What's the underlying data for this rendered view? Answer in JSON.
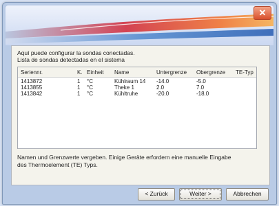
{
  "dialog": {
    "intro_line1": "Aquí puede configurar la sondas conectadas.",
    "intro_line2": "Lista de sondas detectadas en el sistema",
    "close_glyph": "✕"
  },
  "table": {
    "headers": [
      "Seriennr.",
      "K.",
      "Einheit",
      "Name",
      "Untergrenze",
      "Obergrenze",
      "TE-Typ"
    ],
    "rows": [
      [
        "1413872",
        "1",
        "°C",
        "Kühlraum 14",
        "-14.0",
        "-5.0",
        ""
      ],
      [
        "1413855",
        "1",
        "°C",
        "Theke 1",
        "2.0",
        "7.0",
        ""
      ],
      [
        "1413842",
        "1",
        "°C",
        "Kühltruhe",
        "-20.0",
        "-18.0",
        ""
      ]
    ]
  },
  "footer": {
    "line1": "Namen und Grenzwerte vergeben. Einige Geräte erfordern eine manuelle Eingabe",
    "line2": "des Thermoelement (TE) Typs."
  },
  "buttons": {
    "back": "< Zurück",
    "next": "Weiter >",
    "cancel": "Abbrechen"
  }
}
